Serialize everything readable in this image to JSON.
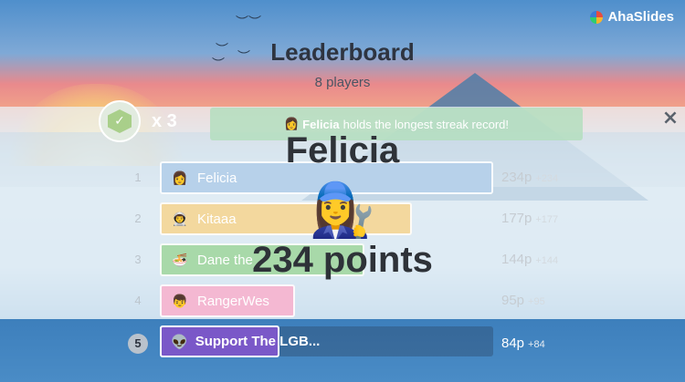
{
  "brand": {
    "name": "AhaSlides"
  },
  "header": {
    "title": "Leaderboard",
    "subtitle": "8 players"
  },
  "streak": {
    "multiplier": "x 3",
    "avatar": "👩",
    "name": "Felicia",
    "message": "holds the longest streak record!"
  },
  "close_icon": "×",
  "rows": [
    {
      "rank": "1",
      "avatar": "👩",
      "name": "Felicia",
      "score": "234p",
      "delta": "+234",
      "color": "#b7d1ea",
      "share": 1.0
    },
    {
      "rank": "2",
      "avatar": "👨‍🚀",
      "name": "Kitaaa",
      "score": "177p",
      "delta": "+177",
      "color": "#f3d89e",
      "share": 0.756
    },
    {
      "rank": "3",
      "avatar": "🍜",
      "name": "Dane the",
      "score": "144p",
      "delta": "+144",
      "color": "#a8d9a9",
      "share": 0.615
    },
    {
      "rank": "4",
      "avatar": "👦",
      "name": "RangerWes",
      "score": "95p",
      "delta": "+95",
      "color": "#f4b8d2",
      "share": 0.406
    }
  ],
  "row5": {
    "rank": "5",
    "avatar": "👽",
    "name": "Support The LGB...",
    "score": "84p",
    "delta": "+84",
    "color": "#7a58c8",
    "share": 0.359
  },
  "winner": {
    "name": "Felicia",
    "avatar": "👩‍🔧",
    "points": "234 points"
  }
}
